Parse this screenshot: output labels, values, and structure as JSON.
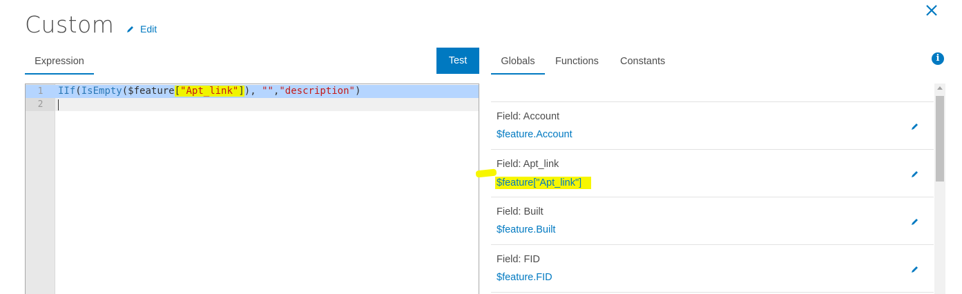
{
  "header": {
    "title": "Custom",
    "edit_label": "Edit",
    "close_icon": "close-icon"
  },
  "editor_tabs": {
    "expression": "Expression",
    "test_button": "Test"
  },
  "reference_tabs": {
    "globals": "Globals",
    "functions": "Functions",
    "constants": "Constants",
    "info_icon": "i"
  },
  "code_editor": {
    "line_numbers": [
      "1",
      "2"
    ],
    "line1": {
      "fn_iif": "IIf",
      "paren_open": "(",
      "fn_isempty": "IsEmpty",
      "feature_open": "($feature",
      "bracket_open": "[",
      "str_field": "\"Apt_link\"",
      "bracket_close": "]",
      "after_field": "), ",
      "str_empty": "\"\"",
      "comma": ",",
      "str_desc": "\"description\"",
      "close": ")"
    }
  },
  "globals_list": [
    {
      "label": "Field: Account",
      "value": "$feature.Account"
    },
    {
      "label": "Field: Apt_link",
      "value": "$feature[\"Apt_link\"]"
    },
    {
      "label": "Field: Built",
      "value": "$feature.Built"
    },
    {
      "label": "Field: FID",
      "value": "$feature.FID"
    }
  ],
  "colors": {
    "accent": "#0079c1",
    "highlight": "#f7f600",
    "selection": "#b5d5ff"
  }
}
